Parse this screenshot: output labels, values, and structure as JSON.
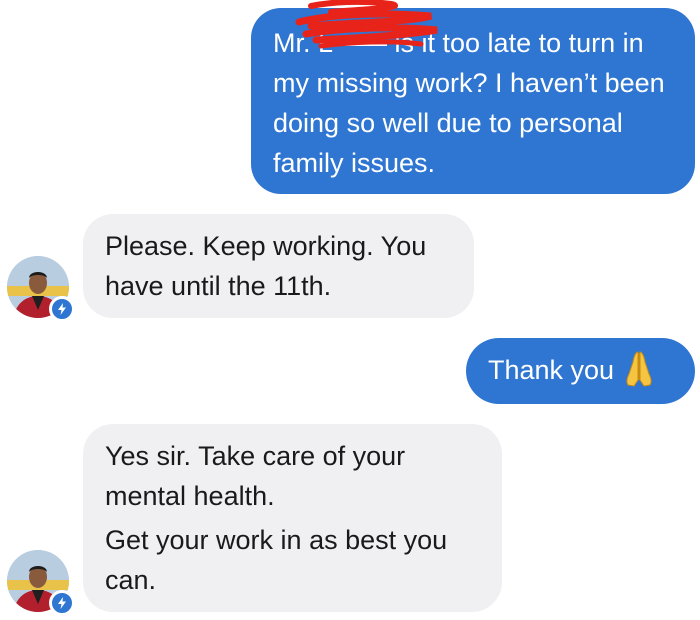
{
  "conversation": {
    "messages": [
      {
        "direction": "outgoing",
        "lines": [
          "Mr. L—— is it too late to turn in my missing work? I haven’t been doing so well due to personal family issues."
        ]
      },
      {
        "direction": "incoming",
        "lines": [
          "Please. Keep working. You have until the 11th."
        ]
      },
      {
        "direction": "outgoing",
        "lines": [
          "Thank you"
        ],
        "emoji": "folded-hands-icon"
      },
      {
        "direction": "incoming",
        "lines": [
          "Yes sir. Take care of your mental health.",
          "Get your work in as best you can."
        ]
      }
    ]
  },
  "colors": {
    "outgoing_bubble": "#2f76d2",
    "incoming_bubble": "#f0f0f2",
    "redaction_scribble": "#e8231a"
  },
  "icons": {
    "avatar_badge": "lightning-bolt-icon",
    "redaction": "red-scribble-redaction"
  }
}
